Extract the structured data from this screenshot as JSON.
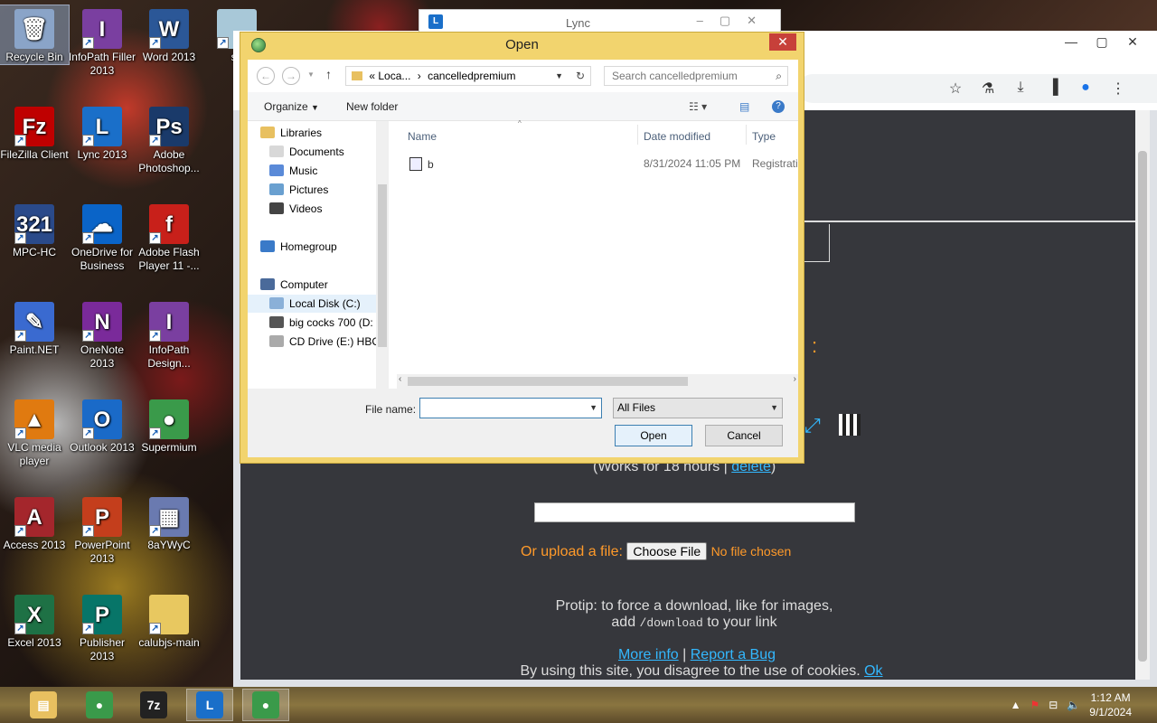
{
  "desktop": {
    "icons": [
      {
        "label": "Recycle Bin",
        "glyph": "🗑",
        "color": "#8aa4c8"
      },
      {
        "label": "InfoPath Filler 2013",
        "glyph": "I",
        "color": "#7a3fa0"
      },
      {
        "label": "Word 2013",
        "glyph": "W",
        "color": "#2b5797"
      },
      {
        "label": "sn",
        "glyph": "",
        "color": "#a8c8d8"
      },
      {
        "label": "FileZilla Client",
        "glyph": "Fz",
        "color": "#bf0000"
      },
      {
        "label": "Lync 2013",
        "glyph": "L",
        "color": "#1a6fc9"
      },
      {
        "label": "Adobe Photoshop...",
        "glyph": "Ps",
        "color": "#1a3a6a"
      },
      {
        "label": "MPC-HC",
        "glyph": "321",
        "color": "#2a4a8a"
      },
      {
        "label": "OneDrive for Business",
        "glyph": "☁",
        "color": "#0a64c8"
      },
      {
        "label": "Adobe Flash Player 11 -...",
        "glyph": "f",
        "color": "#c8201a"
      },
      {
        "label": "Paint.NET",
        "glyph": "✎",
        "color": "#3a6ad0"
      },
      {
        "label": "OneNote 2013",
        "glyph": "N",
        "color": "#7a2a9a"
      },
      {
        "label": "InfoPath Design...",
        "glyph": "I",
        "color": "#7a3fa0"
      },
      {
        "label": "VLC media player",
        "glyph": "▲",
        "color": "#e07a10"
      },
      {
        "label": "Outlook 2013",
        "glyph": "O",
        "color": "#1a6ac8"
      },
      {
        "label": "Supermium",
        "glyph": "●",
        "color": "#3a9a4a"
      },
      {
        "label": "Access 2013",
        "glyph": "A",
        "color": "#a4262c"
      },
      {
        "label": "PowerPoint 2013",
        "glyph": "P",
        "color": "#c43e1c"
      },
      {
        "label": "8aYWyC",
        "glyph": "▦",
        "color": "#6a7ab0"
      },
      {
        "label": "Excel 2013",
        "glyph": "X",
        "color": "#1e7145"
      },
      {
        "label": "Publisher 2013",
        "glyph": "P",
        "color": "#077568"
      },
      {
        "label": "calubjs-main",
        "glyph": "",
        "color": "#e8c860"
      }
    ]
  },
  "lync_window": {
    "title": "Lync"
  },
  "browser": {
    "page": {
      "works_for": "(Works for 18 hours |",
      "delete_link": "delete",
      "works_close": ")",
      "upload_label": "Or upload a file:",
      "choose_file": "Choose File",
      "no_file": "No file chosen",
      "protip_line1": "Protip: to force a download, like for images,",
      "protip_add": "add",
      "protip_code": "/download",
      "protip_tail": "to your link",
      "more_info": "More info",
      "sep": "|",
      "report_bug": "Report a Bug",
      "cookie_text": "By using this site, you disagree to the use of cookies.",
      "cookie_ok": "Ok"
    }
  },
  "dialog": {
    "title": "Open",
    "address": {
      "prefix": "«",
      "part1": "Loca...",
      "sep": "›",
      "part2": "cancelledpremium"
    },
    "search_placeholder": "Search cancelledpremium",
    "organize": "Organize",
    "new_folder": "New folder",
    "nav": [
      {
        "label": "Libraries",
        "color": "#e8c060"
      },
      {
        "label": "Documents",
        "color": "#d8d8d8"
      },
      {
        "label": "Music",
        "color": "#5a8ad8"
      },
      {
        "label": "Pictures",
        "color": "#6aa0d0"
      },
      {
        "label": "Videos",
        "color": "#444"
      },
      {
        "label": "Homegroup",
        "color": "#3a7ac8"
      },
      {
        "label": "Computer",
        "color": "#4a6a9a"
      },
      {
        "label": "Local Disk (C:)",
        "color": "#8ab0d8"
      },
      {
        "label": "big cocks 700 (D:",
        "color": "#555"
      },
      {
        "label": "CD Drive (E:) HBC",
        "color": "#aaa"
      }
    ],
    "columns": {
      "name": "Name",
      "date": "Date modified",
      "type": "Type"
    },
    "files": [
      {
        "name": "b",
        "date": "8/31/2024 11:05 PM",
        "type": "Registratic"
      }
    ],
    "file_name_label": "File name:",
    "file_name_value": "",
    "filter": "All Files",
    "open_btn": "Open",
    "cancel_btn": "Cancel"
  },
  "taskbar": {
    "items": [
      {
        "name": "file-explorer",
        "glyph": "▤",
        "color": "#e8c060"
      },
      {
        "name": "supermium",
        "glyph": "●",
        "color": "#3a9a4a"
      },
      {
        "name": "7zip",
        "glyph": "7z",
        "color": "#222"
      },
      {
        "name": "lync",
        "glyph": "L",
        "color": "#1a6fc9"
      },
      {
        "name": "supermium-active",
        "glyph": "●",
        "color": "#3a9a4a"
      }
    ],
    "time": "1:12 AM",
    "date": "9/1/2024"
  }
}
